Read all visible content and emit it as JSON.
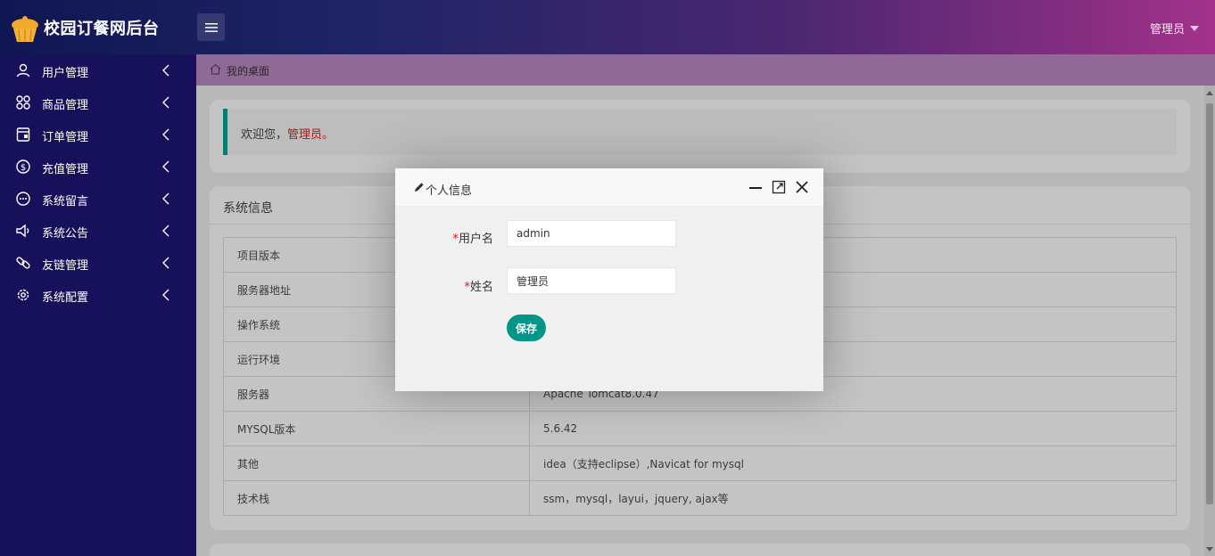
{
  "header": {
    "app_title": "校园订餐网后台",
    "user_label": "管理员"
  },
  "sidebar": {
    "items": [
      {
        "label": "用户管理",
        "icon": "user-icon"
      },
      {
        "label": "商品管理",
        "icon": "product-grid-icon"
      },
      {
        "label": "订单管理",
        "icon": "order-icon"
      },
      {
        "label": "充值管理",
        "icon": "dollar-coin-icon"
      },
      {
        "label": "系统留言",
        "icon": "message-icon"
      },
      {
        "label": "系统公告",
        "icon": "speaker-icon"
      },
      {
        "label": "友链管理",
        "icon": "link-icon"
      },
      {
        "label": "系统配置",
        "icon": "gear-icon"
      }
    ]
  },
  "breadcrumb": {
    "label": "我的桌面"
  },
  "welcome": {
    "prefix": "欢迎您，",
    "name": "管理员。"
  },
  "system_info": {
    "title": "系统信息",
    "rows": [
      {
        "key": "项目版本",
        "value": ""
      },
      {
        "key": "服务器地址",
        "value": ""
      },
      {
        "key": "操作系统",
        "value": ""
      },
      {
        "key": "运行环境",
        "value": ""
      },
      {
        "key": "服务器",
        "value": "Apache Tomcat8.0.47"
      },
      {
        "key": "MYSQL版本",
        "value": "5.6.42"
      },
      {
        "key": "其他",
        "value": "idea（支持eclipse）,Navicat for mysql"
      },
      {
        "key": "技术栈",
        "value": "ssm，mysql，layui，jquery, ajax等"
      }
    ]
  },
  "modal": {
    "title": "个人信息",
    "username_label": "用户名",
    "username_value": "admin",
    "name_label": "姓名",
    "name_value": "管理员",
    "required_mark": "*",
    "save_label": "保存"
  },
  "colors": {
    "sidebar_bg": "#16115a",
    "accent": "#009688",
    "welcome_name": "#b31313"
  }
}
